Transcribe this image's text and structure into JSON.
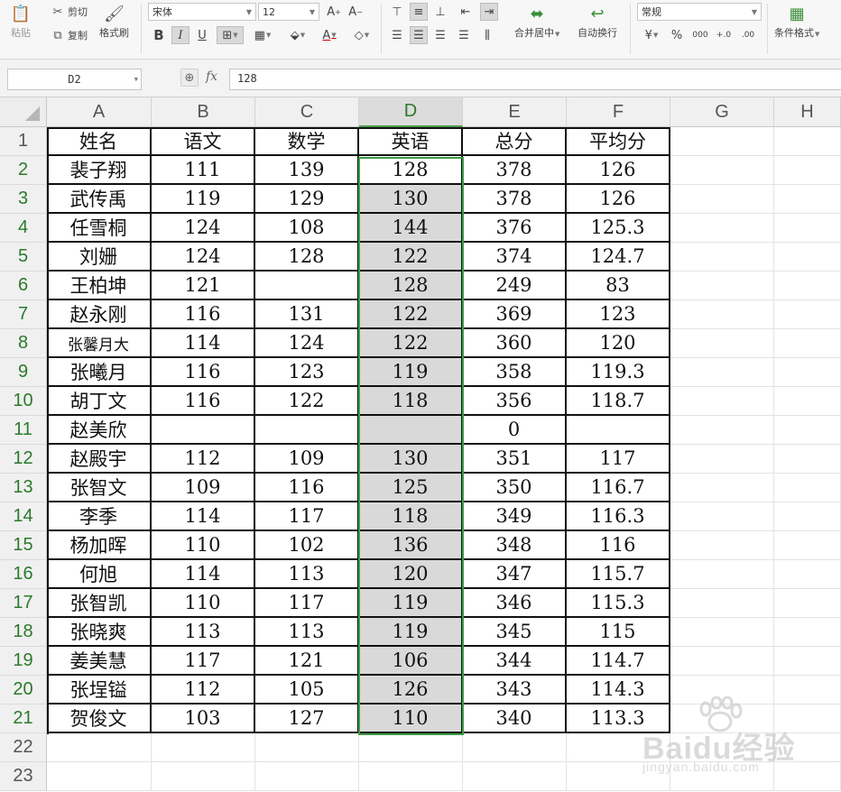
{
  "ribbon": {
    "paste": "粘贴",
    "cut": "剪切",
    "copy": "复制",
    "format_painter": "格式刷",
    "font_name": "宋体",
    "font_size": "12",
    "merge_center": "合并居中",
    "wrap_text": "自动换行",
    "number_format": "常规",
    "currency_symbol": "¥",
    "percent_symbol": "%",
    "thousands_symbol": "000",
    "conditional_format": "条件格式"
  },
  "formula_bar": {
    "name_box": "D2",
    "fx": "fx",
    "value": "128"
  },
  "columns": [
    "A",
    "B",
    "C",
    "D",
    "E",
    "F",
    "G",
    "H"
  ],
  "rows": [
    "1",
    "2",
    "3",
    "4",
    "5",
    "6",
    "7",
    "8",
    "9",
    "10",
    "11",
    "12",
    "13",
    "14",
    "15",
    "16",
    "17",
    "18",
    "19",
    "20",
    "21",
    "22",
    "23"
  ],
  "table": {
    "header": [
      "姓名",
      "语文",
      "数学",
      "英语",
      "总分",
      "平均分"
    ],
    "rows": [
      [
        "裴子翔",
        "111",
        "139",
        "128",
        "378",
        "126"
      ],
      [
        "武传禹",
        "119",
        "129",
        "130",
        "378",
        "126"
      ],
      [
        "任雪桐",
        "124",
        "108",
        "144",
        "376",
        "125.3"
      ],
      [
        "刘姗",
        "124",
        "128",
        "122",
        "374",
        "124.7"
      ],
      [
        "王柏坤",
        "121",
        "",
        "128",
        "249",
        "83"
      ],
      [
        "赵永刚",
        "116",
        "131",
        "122",
        "369",
        "123"
      ],
      [
        "张馨月大",
        "114",
        "124",
        "122",
        "360",
        "120"
      ],
      [
        "张曦月",
        "116",
        "123",
        "119",
        "358",
        "119.3"
      ],
      [
        "胡丁文",
        "116",
        "122",
        "118",
        "356",
        "118.7"
      ],
      [
        "赵美欣",
        "",
        "",
        "",
        "0",
        ""
      ],
      [
        "赵殿宇",
        "112",
        "109",
        "130",
        "351",
        "117"
      ],
      [
        "张智文",
        "109",
        "116",
        "125",
        "350",
        "116.7"
      ],
      [
        "李季",
        "114",
        "117",
        "118",
        "349",
        "116.3"
      ],
      [
        "杨加晖",
        "110",
        "102",
        "136",
        "348",
        "116"
      ],
      [
        "何旭",
        "114",
        "113",
        "120",
        "347",
        "115.7"
      ],
      [
        "张智凯",
        "110",
        "117",
        "119",
        "346",
        "115.3"
      ],
      [
        "张晓爽",
        "113",
        "113",
        "119",
        "345",
        "115"
      ],
      [
        "姜美慧",
        "117",
        "121",
        "106",
        "344",
        "114.7"
      ],
      [
        "张埕镒",
        "112",
        "105",
        "126",
        "343",
        "114.3"
      ],
      [
        "贺俊文",
        "103",
        "127",
        "110",
        "340",
        "113.3"
      ]
    ]
  },
  "watermark": {
    "brand": "Baidu经验",
    "url": "jingyan.baidu.com"
  }
}
